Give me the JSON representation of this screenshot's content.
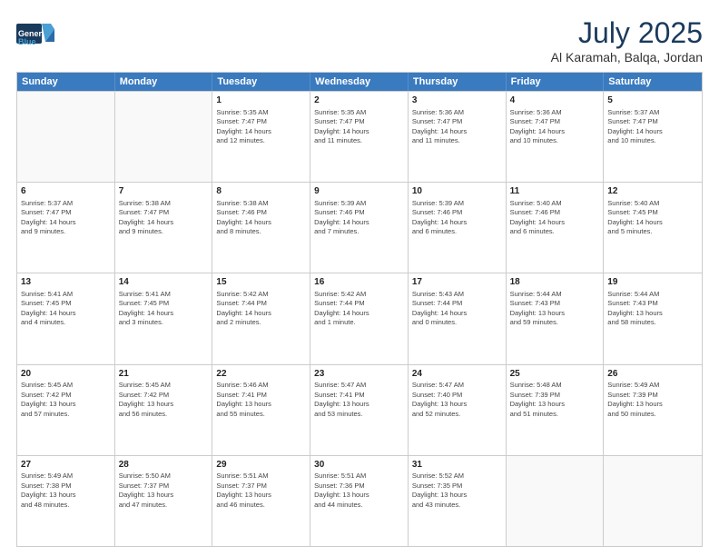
{
  "header": {
    "logo_general": "General",
    "logo_blue": "Blue",
    "title": "July 2025",
    "location": "Al Karamah, Balqa, Jordan"
  },
  "days_of_week": [
    "Sunday",
    "Monday",
    "Tuesday",
    "Wednesday",
    "Thursday",
    "Friday",
    "Saturday"
  ],
  "rows": [
    [
      {
        "num": "",
        "empty": true
      },
      {
        "num": "",
        "empty": true
      },
      {
        "num": "1",
        "lines": [
          "Sunrise: 5:35 AM",
          "Sunset: 7:47 PM",
          "Daylight: 14 hours",
          "and 12 minutes."
        ]
      },
      {
        "num": "2",
        "lines": [
          "Sunrise: 5:35 AM",
          "Sunset: 7:47 PM",
          "Daylight: 14 hours",
          "and 11 minutes."
        ]
      },
      {
        "num": "3",
        "lines": [
          "Sunrise: 5:36 AM",
          "Sunset: 7:47 PM",
          "Daylight: 14 hours",
          "and 11 minutes."
        ]
      },
      {
        "num": "4",
        "lines": [
          "Sunrise: 5:36 AM",
          "Sunset: 7:47 PM",
          "Daylight: 14 hours",
          "and 10 minutes."
        ]
      },
      {
        "num": "5",
        "lines": [
          "Sunrise: 5:37 AM",
          "Sunset: 7:47 PM",
          "Daylight: 14 hours",
          "and 10 minutes."
        ]
      }
    ],
    [
      {
        "num": "6",
        "lines": [
          "Sunrise: 5:37 AM",
          "Sunset: 7:47 PM",
          "Daylight: 14 hours",
          "and 9 minutes."
        ]
      },
      {
        "num": "7",
        "lines": [
          "Sunrise: 5:38 AM",
          "Sunset: 7:47 PM",
          "Daylight: 14 hours",
          "and 9 minutes."
        ]
      },
      {
        "num": "8",
        "lines": [
          "Sunrise: 5:38 AM",
          "Sunset: 7:46 PM",
          "Daylight: 14 hours",
          "and 8 minutes."
        ]
      },
      {
        "num": "9",
        "lines": [
          "Sunrise: 5:39 AM",
          "Sunset: 7:46 PM",
          "Daylight: 14 hours",
          "and 7 minutes."
        ]
      },
      {
        "num": "10",
        "lines": [
          "Sunrise: 5:39 AM",
          "Sunset: 7:46 PM",
          "Daylight: 14 hours",
          "and 6 minutes."
        ]
      },
      {
        "num": "11",
        "lines": [
          "Sunrise: 5:40 AM",
          "Sunset: 7:46 PM",
          "Daylight: 14 hours",
          "and 6 minutes."
        ]
      },
      {
        "num": "12",
        "lines": [
          "Sunrise: 5:40 AM",
          "Sunset: 7:45 PM",
          "Daylight: 14 hours",
          "and 5 minutes."
        ]
      }
    ],
    [
      {
        "num": "13",
        "lines": [
          "Sunrise: 5:41 AM",
          "Sunset: 7:45 PM",
          "Daylight: 14 hours",
          "and 4 minutes."
        ]
      },
      {
        "num": "14",
        "lines": [
          "Sunrise: 5:41 AM",
          "Sunset: 7:45 PM",
          "Daylight: 14 hours",
          "and 3 minutes."
        ]
      },
      {
        "num": "15",
        "lines": [
          "Sunrise: 5:42 AM",
          "Sunset: 7:44 PM",
          "Daylight: 14 hours",
          "and 2 minutes."
        ]
      },
      {
        "num": "16",
        "lines": [
          "Sunrise: 5:42 AM",
          "Sunset: 7:44 PM",
          "Daylight: 14 hours",
          "and 1 minute."
        ]
      },
      {
        "num": "17",
        "lines": [
          "Sunrise: 5:43 AM",
          "Sunset: 7:44 PM",
          "Daylight: 14 hours",
          "and 0 minutes."
        ]
      },
      {
        "num": "18",
        "lines": [
          "Sunrise: 5:44 AM",
          "Sunset: 7:43 PM",
          "Daylight: 13 hours",
          "and 59 minutes."
        ]
      },
      {
        "num": "19",
        "lines": [
          "Sunrise: 5:44 AM",
          "Sunset: 7:43 PM",
          "Daylight: 13 hours",
          "and 58 minutes."
        ]
      }
    ],
    [
      {
        "num": "20",
        "lines": [
          "Sunrise: 5:45 AM",
          "Sunset: 7:42 PM",
          "Daylight: 13 hours",
          "and 57 minutes."
        ]
      },
      {
        "num": "21",
        "lines": [
          "Sunrise: 5:45 AM",
          "Sunset: 7:42 PM",
          "Daylight: 13 hours",
          "and 56 minutes."
        ]
      },
      {
        "num": "22",
        "lines": [
          "Sunrise: 5:46 AM",
          "Sunset: 7:41 PM",
          "Daylight: 13 hours",
          "and 55 minutes."
        ]
      },
      {
        "num": "23",
        "lines": [
          "Sunrise: 5:47 AM",
          "Sunset: 7:41 PM",
          "Daylight: 13 hours",
          "and 53 minutes."
        ]
      },
      {
        "num": "24",
        "lines": [
          "Sunrise: 5:47 AM",
          "Sunset: 7:40 PM",
          "Daylight: 13 hours",
          "and 52 minutes."
        ]
      },
      {
        "num": "25",
        "lines": [
          "Sunrise: 5:48 AM",
          "Sunset: 7:39 PM",
          "Daylight: 13 hours",
          "and 51 minutes."
        ]
      },
      {
        "num": "26",
        "lines": [
          "Sunrise: 5:49 AM",
          "Sunset: 7:39 PM",
          "Daylight: 13 hours",
          "and 50 minutes."
        ]
      }
    ],
    [
      {
        "num": "27",
        "lines": [
          "Sunrise: 5:49 AM",
          "Sunset: 7:38 PM",
          "Daylight: 13 hours",
          "and 48 minutes."
        ]
      },
      {
        "num": "28",
        "lines": [
          "Sunrise: 5:50 AM",
          "Sunset: 7:37 PM",
          "Daylight: 13 hours",
          "and 47 minutes."
        ]
      },
      {
        "num": "29",
        "lines": [
          "Sunrise: 5:51 AM",
          "Sunset: 7:37 PM",
          "Daylight: 13 hours",
          "and 46 minutes."
        ]
      },
      {
        "num": "30",
        "lines": [
          "Sunrise: 5:51 AM",
          "Sunset: 7:36 PM",
          "Daylight: 13 hours",
          "and 44 minutes."
        ]
      },
      {
        "num": "31",
        "lines": [
          "Sunrise: 5:52 AM",
          "Sunset: 7:35 PM",
          "Daylight: 13 hours",
          "and 43 minutes."
        ]
      },
      {
        "num": "",
        "empty": true
      },
      {
        "num": "",
        "empty": true
      }
    ]
  ]
}
